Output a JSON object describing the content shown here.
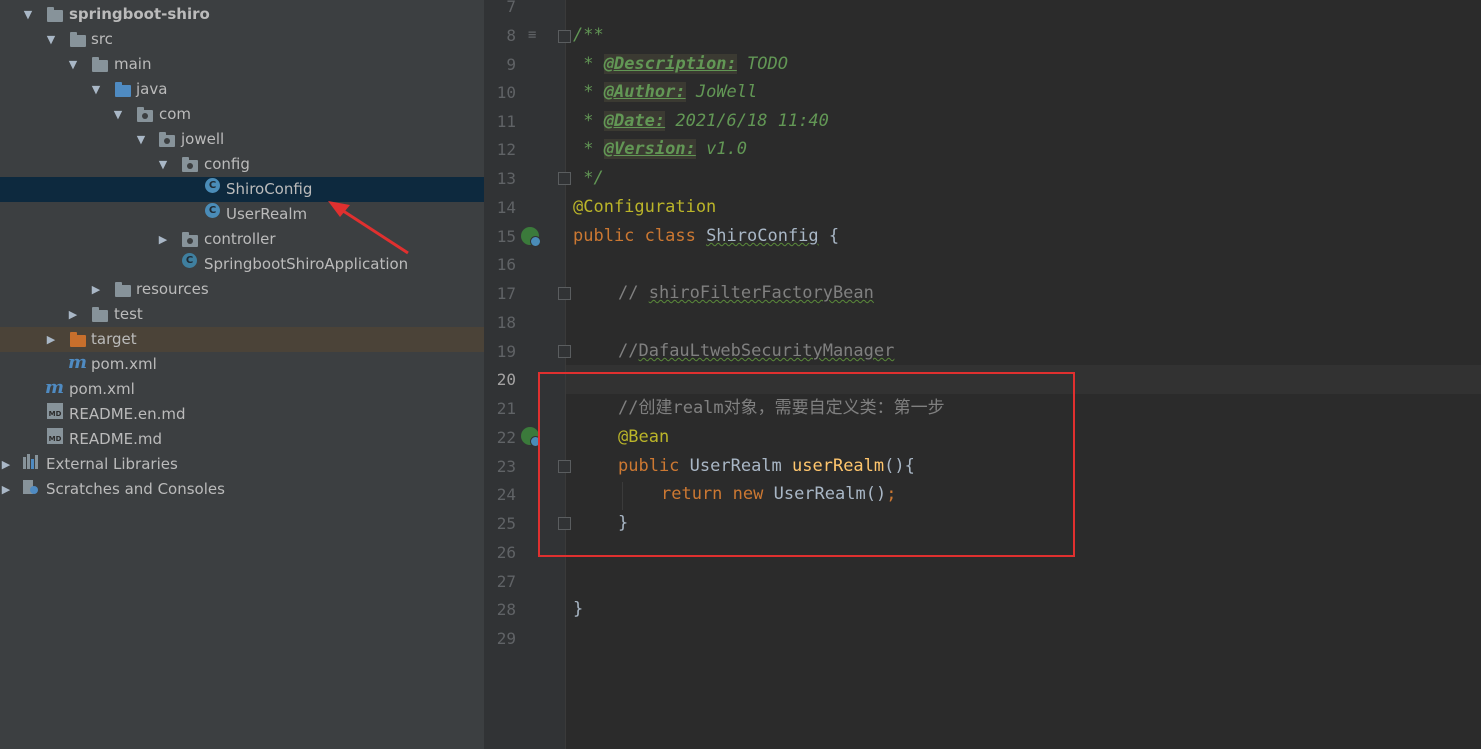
{
  "project_tree": {
    "items": [
      {
        "label": "springboot-shiro",
        "bold": true
      },
      {
        "label": "src"
      },
      {
        "label": "main"
      },
      {
        "label": "java"
      },
      {
        "label": "com"
      },
      {
        "label": "jowell"
      },
      {
        "label": "config"
      },
      {
        "label": "ShiroConfig"
      },
      {
        "label": "UserRealm"
      },
      {
        "label": "controller"
      },
      {
        "label": "SpringbootShiroApplication"
      },
      {
        "label": "resources"
      },
      {
        "label": "test"
      },
      {
        "label": "target"
      },
      {
        "label": "pom.xml"
      },
      {
        "label": "pom.xml"
      },
      {
        "label": "README.en.md"
      },
      {
        "label": "README.md"
      },
      {
        "label": "External Libraries"
      },
      {
        "label": "Scratches and Consoles"
      }
    ],
    "md_badge": "MD"
  },
  "editor": {
    "line_numbers": [
      "7",
      "8",
      "9",
      "10",
      "11",
      "12",
      "13",
      "14",
      "15",
      "16",
      "17",
      "18",
      "19",
      "20",
      "21",
      "22",
      "23",
      "24",
      "25",
      "26",
      "27",
      "28",
      "29"
    ],
    "current_line": "20",
    "code": {
      "l8": "/**",
      "l9_star": " * ",
      "l9_tag": "@Description:",
      "l9_val": " TODO",
      "l10_star": " * ",
      "l10_tag": "@Author:",
      "l10_val": " JoWell",
      "l11_star": " * ",
      "l11_tag": "@Date:",
      "l11_val": " 2021/6/18 11:40",
      "l12_star": " * ",
      "l12_tag": "@Version:",
      "l12_val": " v1.0",
      "l13": " */",
      "l14": "@Configuration",
      "l15_kw": "public class ",
      "l15_name": "ShiroConfig",
      "l15_rest": " {",
      "l17_prefix": "// ",
      "l17_text": "shiroFilterFactoryBean",
      "l19_prefix": "//",
      "l19_text": "DafauLtwebSecurityManager",
      "l21": "//创建realm对象，需要自定义类：第一步",
      "l22": "@Bean",
      "l23_kw": "public ",
      "l23_type": "UserRealm ",
      "l23_fn": "userRealm",
      "l23_rest": "(){",
      "l24_kw": "return new ",
      "l24_rest": "UserRealm()",
      "l24_semi": ";",
      "l25": "}",
      "l28": "}"
    }
  },
  "colors": {
    "keyword": "#cc7832",
    "annotation": "#bbb529",
    "comment": "#808080",
    "doc": "#629755",
    "function": "#ffc66d",
    "highlight": "#e0302f"
  }
}
